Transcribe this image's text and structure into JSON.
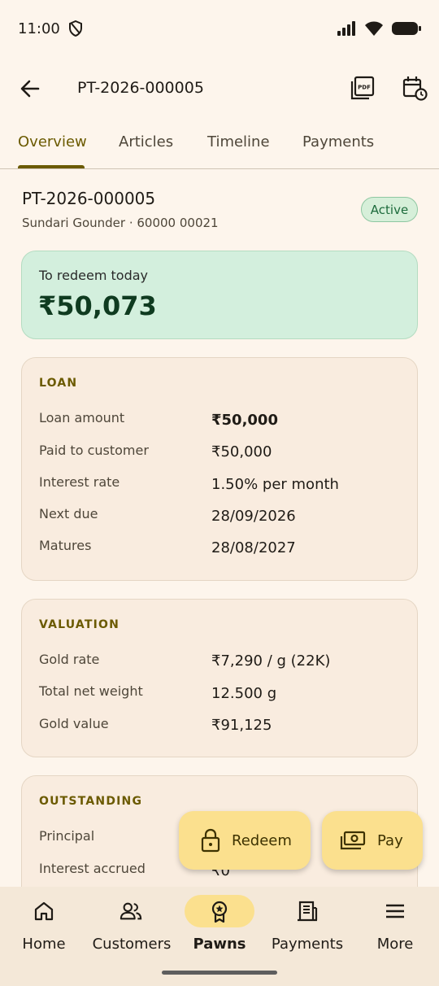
{
  "status_bar": {
    "time": "11:00"
  },
  "app_bar": {
    "title": "PT-2026-000005",
    "pdf_icon_text": "PDF"
  },
  "tabs": [
    {
      "label": "Overview"
    },
    {
      "label": "Articles"
    },
    {
      "label": "Timeline"
    },
    {
      "label": "Payments"
    }
  ],
  "header": {
    "ticket_id": "PT-2026-000005",
    "customer": "Sundari Gounder · 60000 00021",
    "status": "Active"
  },
  "redeem_card": {
    "label": "To redeem today",
    "amount": "₹50,073"
  },
  "loan": {
    "heading": "LOAN",
    "rows": [
      {
        "label": "Loan amount",
        "value": "₹50,000"
      },
      {
        "label": "Paid to customer",
        "value": "₹50,000"
      },
      {
        "label": "Interest rate",
        "value": "1.50% per month"
      },
      {
        "label": "Next due",
        "value": "28/09/2026"
      },
      {
        "label": "Matures",
        "value": "28/08/2027"
      }
    ]
  },
  "valuation": {
    "heading": "VALUATION",
    "rows": [
      {
        "label": "Gold rate",
        "value": "₹7,290 / g (22K)"
      },
      {
        "label": "Total net weight",
        "value": "12.500 g"
      },
      {
        "label": "Gold value",
        "value": "₹91,125"
      }
    ]
  },
  "outstanding": {
    "heading": "OUTSTANDING",
    "rows": [
      {
        "label": "Principal",
        "value": ""
      },
      {
        "label": "Interest accrued",
        "value": "₹0"
      }
    ]
  },
  "actions": {
    "redeem": "Redeem",
    "pay": "Pay"
  },
  "nav": [
    {
      "label": "Home",
      "icon": "home-icon"
    },
    {
      "label": "Customers",
      "icon": "people-icon"
    },
    {
      "label": "Pawns",
      "icon": "medal-icon"
    },
    {
      "label": "Payments",
      "icon": "receipt-icon"
    },
    {
      "label": "More",
      "icon": "menu-icon"
    }
  ],
  "colors": {
    "accent": "#6b5a00",
    "fab": "#fbe08e",
    "redeem_card": "#d3efdd",
    "badge_text": "#1d6b3c"
  }
}
